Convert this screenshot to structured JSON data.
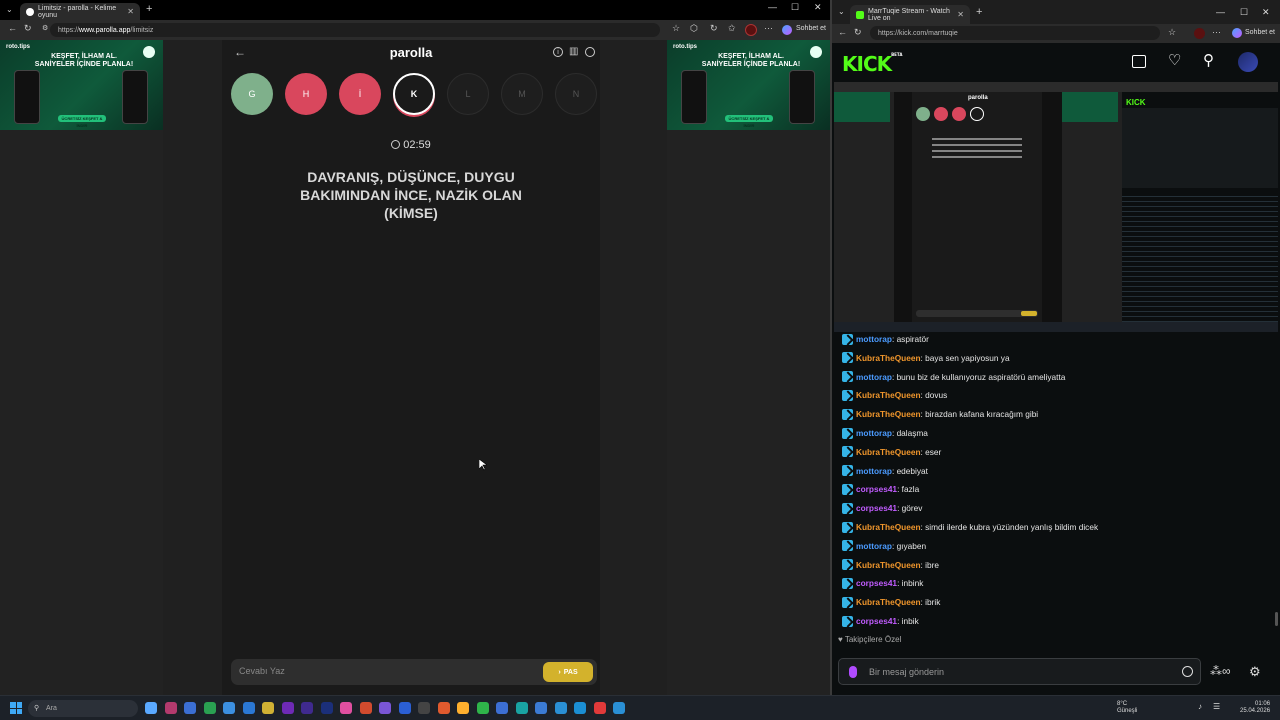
{
  "left_browser": {
    "tab_title": "Limitsiz - parolla - Kelime oyunu",
    "url_prefix": "https://",
    "url_domain": "www.parolla.app",
    "url_path": "/limitsiz",
    "chat_button": "Sohbet et"
  },
  "ad": {
    "brand": "roto.tips",
    "headline": "KEŞFET, İLHAM AL. SANİYELER İÇİNDE PLANLA!",
    "cta": "ÜCRETSİZ KEŞFET & İNDİR"
  },
  "game": {
    "title": "parolla",
    "letters": [
      {
        "letter": "G",
        "state": "correct",
        "color": "#7fb08b"
      },
      {
        "letter": "H",
        "state": "wrong",
        "color": "#d9475d"
      },
      {
        "letter": "İ",
        "state": "wrong",
        "color": "#d9475d"
      },
      {
        "letter": "K",
        "state": "current",
        "color": "#1a1a1a"
      },
      {
        "letter": "L",
        "state": "pending",
        "color": "#1e1e1e"
      },
      {
        "letter": "M",
        "state": "pending",
        "color": "#1e1e1e"
      },
      {
        "letter": "N",
        "state": "pending",
        "color": "#1e1e1e"
      }
    ],
    "timer": "02:59",
    "question": "DAVRANIŞ, DÜŞÜNCE, DUYGU BAKIMINDAN İNCE, NAZİK OLAN (KİMSE)",
    "answer_placeholder": "Cevabı Yaz",
    "pass_label": "PAS"
  },
  "right_browser": {
    "tab_title": "MarrTuqie Stream - Watch Live on",
    "url": "https://kick.com/marrtuqie",
    "chat_button": "Sohbet et",
    "kick_logo": "KICK",
    "beta": "BETA"
  },
  "chat": {
    "messages": [
      {
        "user": "mottorap",
        "text": ": aspiratör",
        "color": "#4b9bff"
      },
      {
        "user": "KubraTheQueen",
        "text": ": baya sen yapiyosun ya",
        "color": "#f0962c"
      },
      {
        "user": "mottorap",
        "text": ": bunu biz de kullanıyoruz aspiratörü ameliyatta",
        "color": "#4b9bff"
      },
      {
        "user": "KubraTheQueen",
        "text": ": dovus",
        "color": "#f0962c"
      },
      {
        "user": "KubraTheQueen",
        "text": ": birazdan kafana kıracağım gibi",
        "color": "#f0962c"
      },
      {
        "user": "mottorap",
        "text": ": dalaşma",
        "color": "#4b9bff"
      },
      {
        "user": "KubraTheQueen",
        "text": ": eser",
        "color": "#f0962c"
      },
      {
        "user": "mottorap",
        "text": ": edebiyat",
        "color": "#4b9bff"
      },
      {
        "user": "corpses41",
        "text": ": fazla",
        "color": "#c15cff"
      },
      {
        "user": "corpses41",
        "text": ": görev",
        "color": "#c15cff"
      },
      {
        "user": "KubraTheQueen",
        "text": ": simdi ilerde kubra yüzünden yanlış bildim dicek",
        "color": "#f0962c"
      },
      {
        "user": "mottorap",
        "text": ": gıyaben",
        "color": "#4b9bff"
      },
      {
        "user": "KubraTheQueen",
        "text": ": ibre",
        "color": "#f0962c"
      },
      {
        "user": "corpses41",
        "text": ": inbink",
        "color": "#c15cff"
      },
      {
        "user": "KubraTheQueen",
        "text": ": ibrik",
        "color": "#f0962c"
      },
      {
        "user": "corpses41",
        "text": ": inbik",
        "color": "#c15cff"
      }
    ],
    "followers_only": "Takipçilere Özel",
    "input_placeholder": "Bir mesaj gönderin"
  },
  "taskbar": {
    "search_placeholder": "Ara",
    "weather_temp": "8°C",
    "weather_desc": "Güneşli",
    "time": "01:06",
    "date": "25.04.2026"
  }
}
